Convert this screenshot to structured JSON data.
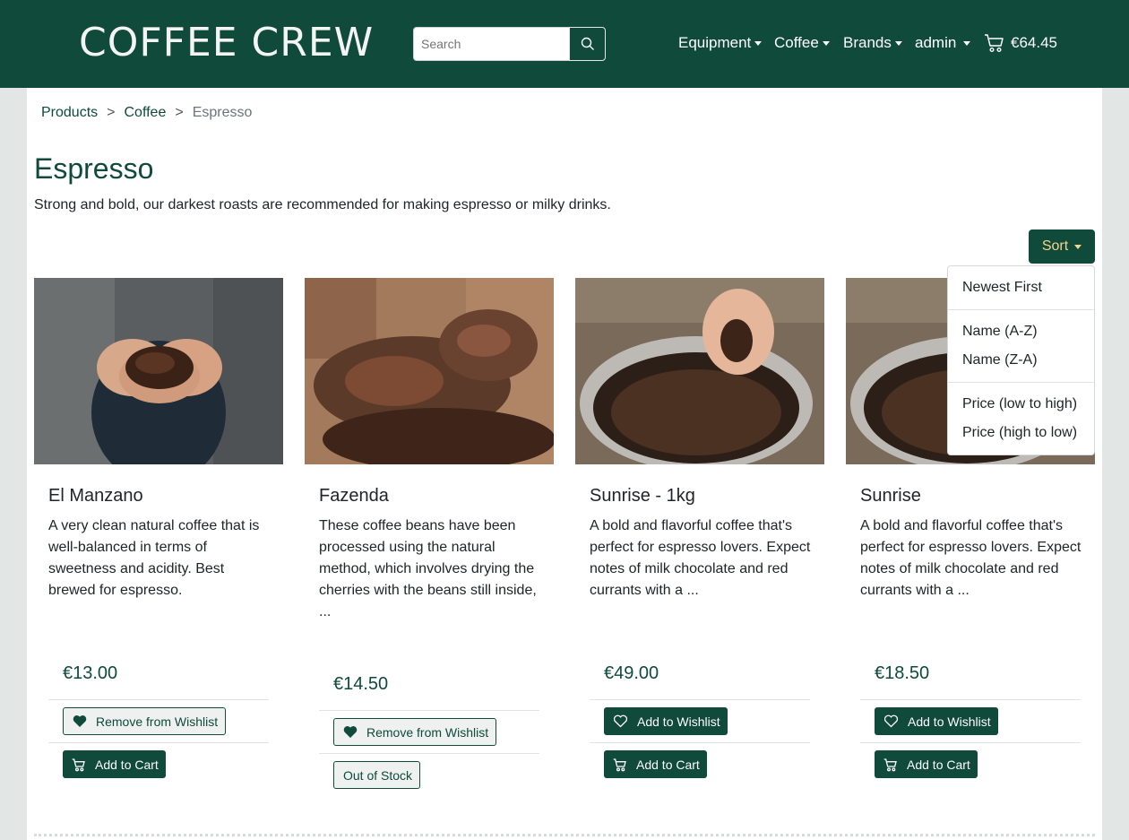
{
  "header": {
    "brand": "COFFEE CREW",
    "search_placeholder": "Search",
    "nav": [
      "Equipment",
      "Coffee",
      "Brands",
      "admin"
    ],
    "cart_total": "€64.45",
    "colors": {
      "primary": "#0f4a3a",
      "sort_text": "#f6d58a"
    }
  },
  "breadcrumb": {
    "products": "Products",
    "coffee": "Coffee",
    "current": "Espresso",
    "sep": ">"
  },
  "page": {
    "title": "Espresso",
    "description": "Strong and bold, our darkest roasts are recommended for making espresso or milky drinks."
  },
  "sort": {
    "label": "Sort",
    "options": [
      "Newest First",
      "Name (A-Z)",
      "Name (Z-A)",
      "Price (low to high)",
      "Price (high to low)"
    ]
  },
  "products": [
    {
      "name": "El Manzano",
      "description": "A very clean natural coffee that is well-balanced in terms of sweetness and acidity. Best brewed for espresso.",
      "price": "€13.00",
      "wishlist": "Remove from Wishlist",
      "action": "Add to Cart"
    },
    {
      "name": "Fazenda",
      "description": "These coffee beans have been processed using the natural method, which involves drying the cherries with the beans still inside, ...",
      "price": "€14.50",
      "wishlist": "Remove from Wishlist",
      "action": "Out of Stock"
    },
    {
      "name": "Sunrise - 1kg",
      "description": "A bold and flavorful coffee that's perfect for espresso lovers. Expect notes of milk chocolate and red currants with a ...",
      "price": "€49.00",
      "wishlist": "Add to Wishlist",
      "action": "Add to Cart"
    },
    {
      "name": "Sunrise",
      "description": "A bold and flavorful coffee that's perfect for espresso lovers. Expect notes of milk chocolate and red currants with a ...",
      "price": "€18.50",
      "wishlist": "Add to Wishlist",
      "action": "Add to Cart"
    }
  ]
}
